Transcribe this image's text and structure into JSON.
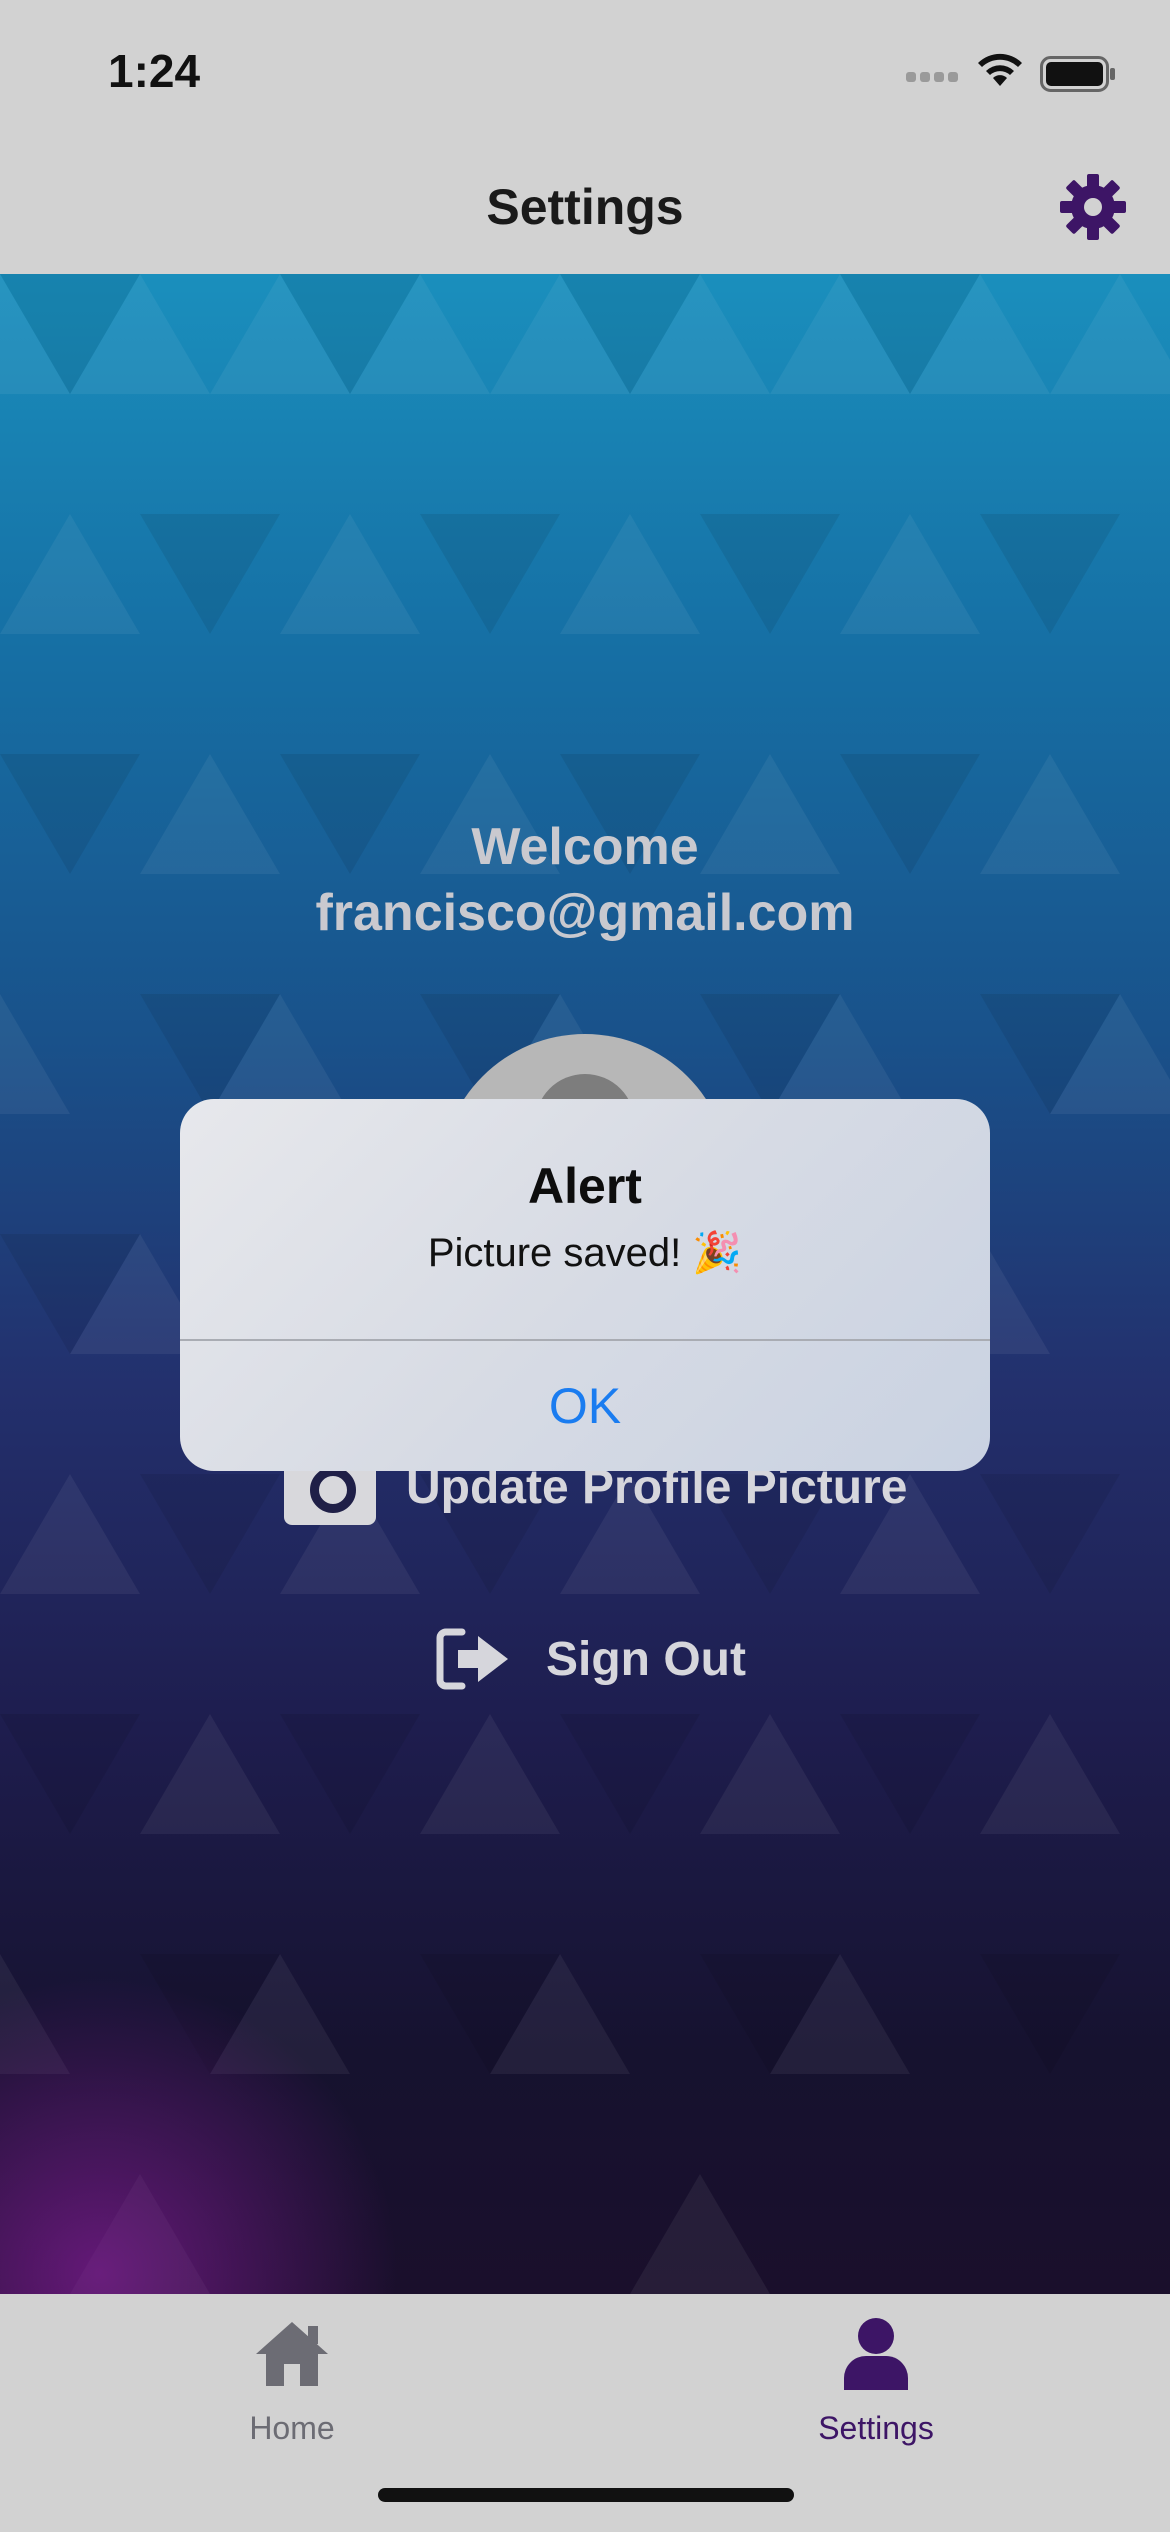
{
  "status_bar": {
    "time": "1:24"
  },
  "nav": {
    "title": "Settings",
    "settings_icon": "gear-icon"
  },
  "profile": {
    "welcome": "Welcome",
    "email": "francisco@gmail.com",
    "update_picture_label": "Update Profile Picture",
    "sign_out_label": "Sign Out"
  },
  "alert": {
    "title": "Alert",
    "message": "Picture saved! 🎉",
    "ok_label": "OK"
  },
  "tab_bar": {
    "items": [
      {
        "label": "Home",
        "icon": "home-icon",
        "selected": false
      },
      {
        "label": "Settings",
        "icon": "person-icon",
        "selected": true
      }
    ]
  },
  "colors": {
    "accent": "#3d1566",
    "alert_button": "#1a7cf0"
  }
}
